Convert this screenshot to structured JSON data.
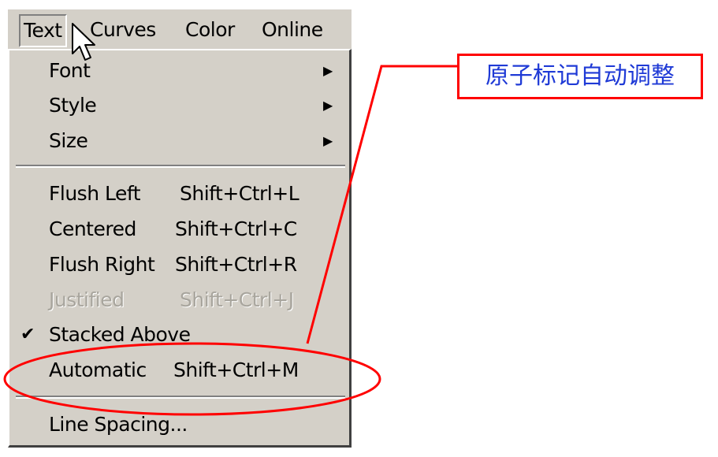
{
  "menubar": {
    "items": [
      {
        "label": "Text"
      },
      {
        "label": "Curves"
      },
      {
        "label": "Color"
      },
      {
        "label": "Online"
      }
    ]
  },
  "menu": {
    "font": {
      "label": "Font"
    },
    "style": {
      "label": "Style"
    },
    "size": {
      "label": "Size"
    },
    "flush_left": {
      "label": "Flush Left",
      "shortcut": "Shift+Ctrl+L"
    },
    "centered": {
      "label": "Centered",
      "shortcut": "Shift+Ctrl+C"
    },
    "flush_right": {
      "label": "Flush Right",
      "shortcut": "Shift+Ctrl+R"
    },
    "justified": {
      "label": "Justified",
      "shortcut": "Shift+Ctrl+J"
    },
    "stacked_above": {
      "label": "Stacked Above",
      "check": "✔"
    },
    "automatic": {
      "label": "Automatic",
      "shortcut": "Shift+Ctrl+M"
    },
    "line_spacing": {
      "label": "Line Spacing..."
    }
  },
  "callout": {
    "text": "原子标记自动调整",
    "color": "#ff0000",
    "text_color": "#1f3ad6"
  },
  "icons": {
    "submenu_arrow": "submenu-arrow-icon",
    "checkmark": "checkmark-icon",
    "cursor": "mouse-pointer-icon"
  }
}
